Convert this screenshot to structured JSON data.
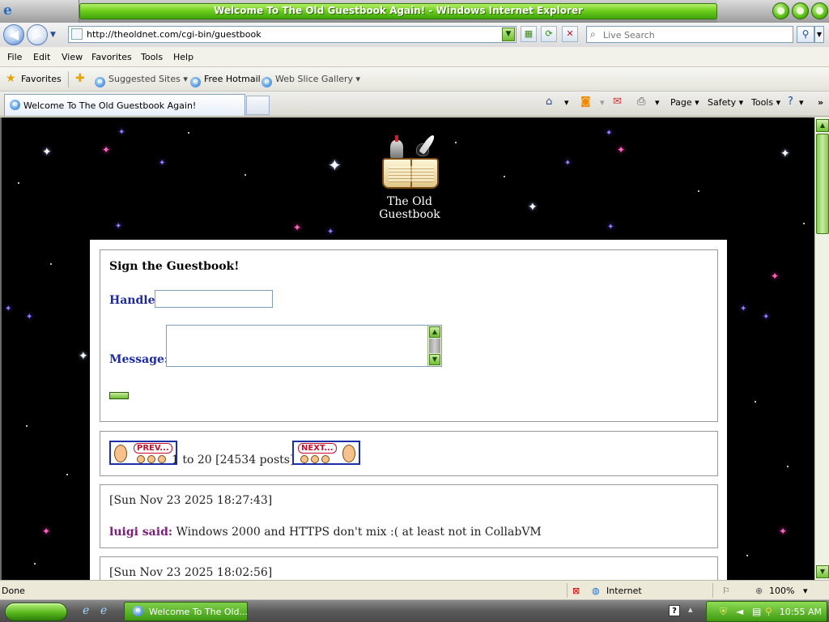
{
  "window": {
    "title": "Welcome To The Old Guestbook Again! - Windows Internet Explorer"
  },
  "address_bar": {
    "url": "http://theoldnet.com/cgi-bin/guestbook",
    "search_placeholder": "Live Search"
  },
  "menu": {
    "items": [
      "File",
      "Edit",
      "View",
      "Favorites",
      "Tools",
      "Help"
    ]
  },
  "favorites_bar": {
    "favorites_label": "Favorites",
    "items": [
      {
        "label": "Suggested Sites ▾"
      },
      {
        "label": "Free Hotmail"
      },
      {
        "label": "Web Slice Gallery ▾"
      }
    ]
  },
  "tabs": {
    "active_tab_label": "Welcome To The Old Guestbook Again!"
  },
  "command_bar": {
    "page_label": "Page",
    "safety_label": "Safety",
    "tools_label": "Tools"
  },
  "page": {
    "site_title": "The Old Guestbook",
    "sign_title": "Sign the Guestbook!",
    "handle_label": "Handle:",
    "message_label": "Message:",
    "handle_value": "",
    "pager": {
      "prev_label": "PREV...",
      "next_label": "NEXT...",
      "range_text": "1 to 20 [24534 posts]"
    },
    "entries": [
      {
        "date": "[Sun Nov 23 2025 18:27:43]",
        "author": "luigi said:",
        "message": "Windows 2000 and HTTPS don't mix :( at least not in CollabVM"
      },
      {
        "date": "[Sun Nov 23 2025 18:02:56]"
      }
    ]
  },
  "status_bar": {
    "status": "Done",
    "zone": "Internet",
    "zoom": "100%"
  },
  "taskbar": {
    "task_label": "Welcome To The Old...",
    "clock": "10:55 AM"
  },
  "colors": {
    "title_green": "#6fcf1e",
    "label_blue": "#1c2aa0",
    "author_purple": "#7a1e7a",
    "page_background": "#000000"
  }
}
